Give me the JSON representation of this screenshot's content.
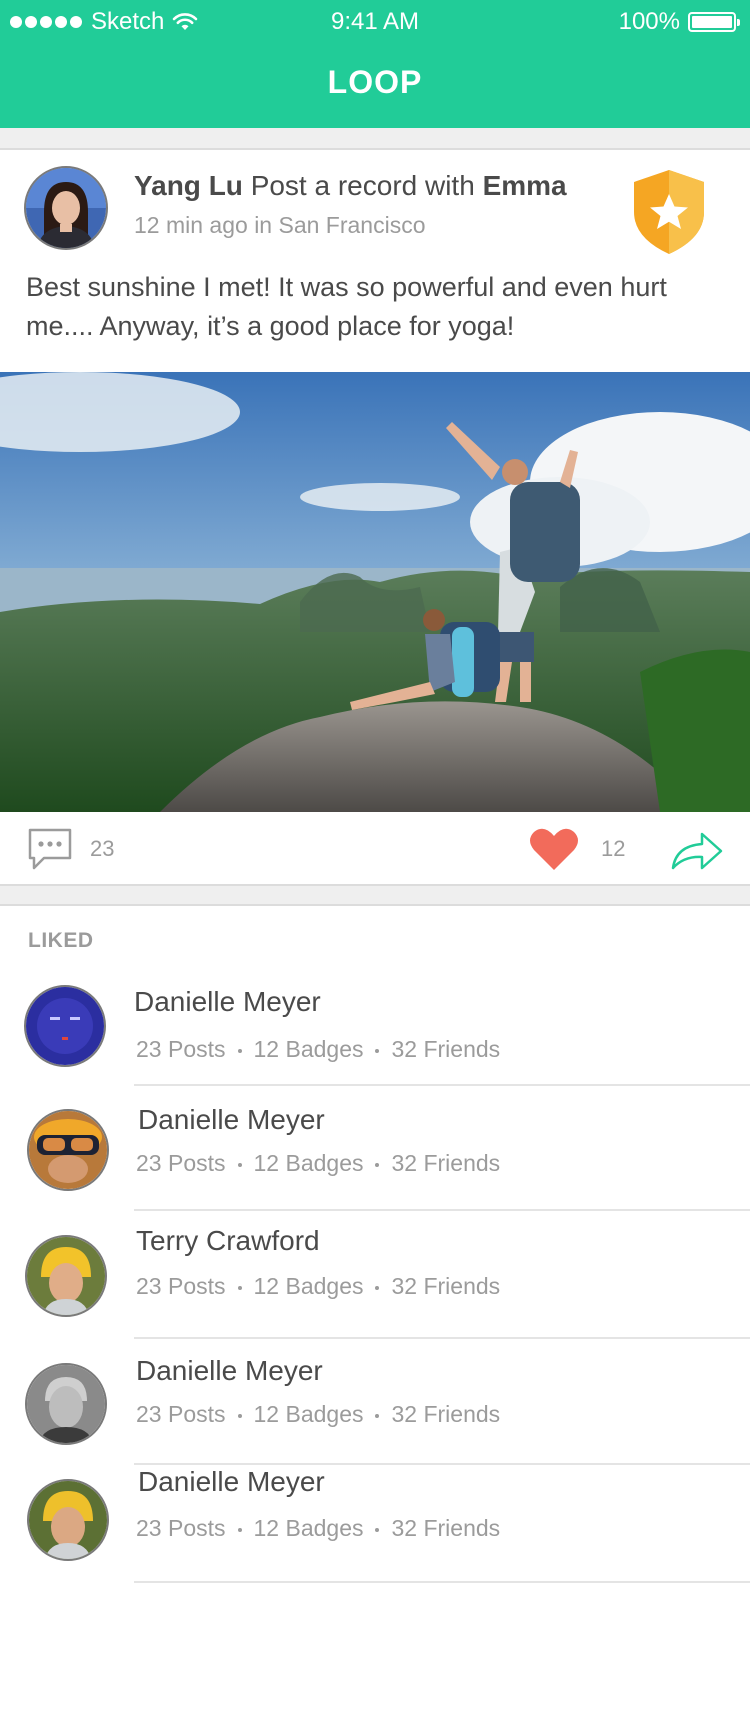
{
  "status_bar": {
    "carrier": "Sketch",
    "time": "9:41 AM",
    "battery": "100%"
  },
  "app": {
    "title": "LOOP"
  },
  "post": {
    "author": "Yang Lu",
    "action_text": "Post a record with",
    "with_user": "Emma",
    "time": "12 min ago in San Francisco",
    "body": "Best sunshine I met! It was so powerful and even hurt me.... Anyway, it’s a good place for yoga!",
    "comments": "23",
    "likes": "12",
    "colors": {
      "accent": "#21cc98",
      "heart": "#f26b5b",
      "badge": "#f5a623"
    }
  },
  "liked": {
    "label": "LIKED",
    "users": [
      {
        "name": "Danielle Meyer",
        "posts": "23 Posts",
        "badges": "12 Badges",
        "friends": "32 Friends"
      },
      {
        "name": "Danielle Meyer",
        "posts": "23 Posts",
        "badges": "12 Badges",
        "friends": "32 Friends"
      },
      {
        "name": "Terry Crawford",
        "posts": "23 Posts",
        "badges": "12 Badges",
        "friends": "32 Friends"
      },
      {
        "name": "Danielle Meyer",
        "posts": "23 Posts",
        "badges": "12 Badges",
        "friends": "32 Friends"
      },
      {
        "name": "Danielle Meyer",
        "posts": "23 Posts",
        "badges": "12 Badges",
        "friends": "32 Friends"
      }
    ]
  }
}
